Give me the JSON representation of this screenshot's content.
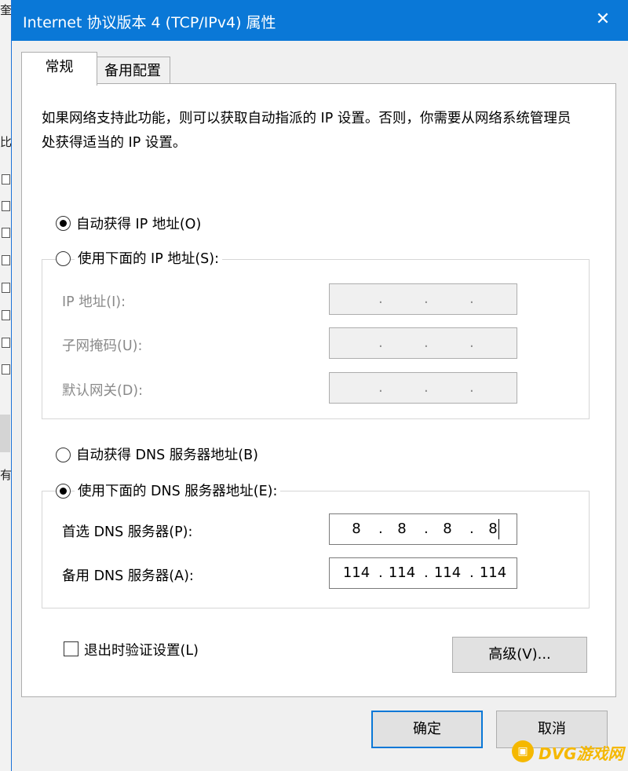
{
  "dialog": {
    "title": "Internet 协议版本 4 (TCP/IPv4) 属性",
    "close_glyph": "✕"
  },
  "tabs": [
    {
      "label": "常规",
      "active": true
    },
    {
      "label": "备用配置",
      "active": false
    }
  ],
  "description": "如果网络支持此功能，则可以获取自动指派的 IP 设置。否则，你需要从网络系统管理员处获得适当的 IP 设置。",
  "ip_options": {
    "auto": {
      "label": "自动获得 IP 地址(O)",
      "checked": true
    },
    "manual": {
      "label": "使用下面的 IP 地址(S):",
      "checked": false
    }
  },
  "ip_fields": [
    {
      "label": "IP 地址(I):",
      "octets": [
        "",
        "",
        "",
        ""
      ]
    },
    {
      "label": "子网掩码(U):",
      "octets": [
        "",
        "",
        "",
        ""
      ]
    },
    {
      "label": "默认网关(D):",
      "octets": [
        "",
        "",
        "",
        ""
      ]
    }
  ],
  "dns_options": {
    "auto": {
      "label": "自动获得 DNS 服务器地址(B)",
      "checked": false
    },
    "manual": {
      "label": "使用下面的 DNS 服务器地址(E):",
      "checked": true
    }
  },
  "dns_fields": [
    {
      "label": "首选 DNS 服务器(P):",
      "octets": [
        "8",
        "8",
        "8",
        "8"
      ]
    },
    {
      "label": "备用 DNS 服务器(A):",
      "octets": [
        "114",
        "114",
        "114",
        "114"
      ]
    }
  ],
  "validate_checkbox": {
    "label": "退出时验证设置(L)",
    "checked": false
  },
  "buttons": {
    "advanced": "高级(V)...",
    "ok": "确定",
    "cancel": "取消"
  },
  "background_window": {
    "glyphs": [
      "奎",
      "比",
      "有"
    ]
  },
  "watermark": {
    "icon": "▣",
    "text": "DVG游戏网"
  },
  "colors": {
    "titlebar": "#0a78d7",
    "dialog_bg": "#f0f0f0",
    "panel_bg": "#ffffff",
    "disabled_text": "#8a8a8a",
    "watermark": "#f5b800"
  }
}
